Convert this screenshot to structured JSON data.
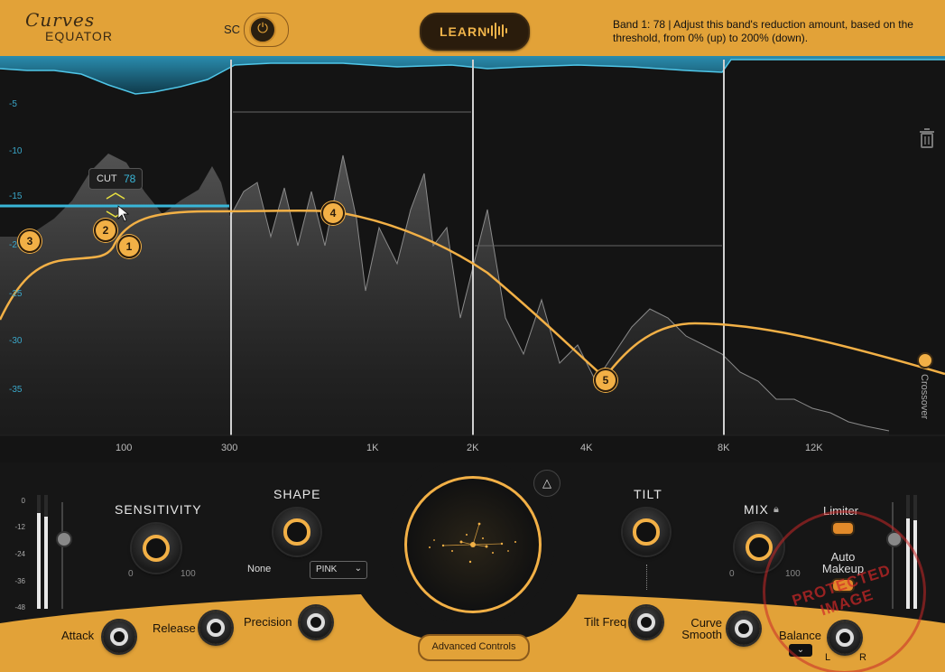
{
  "header": {
    "logo_line1": "Curves",
    "logo_line2": "EQUATOR",
    "sc_label": "SC",
    "learn_label": "LEARN",
    "hint_text": "Band 1: 78 | Adjust this band's reduction amount, based on the threshold, from 0% (up) to 200% (down)."
  },
  "graph": {
    "y_ticks": [
      "-5",
      "-10",
      "-15",
      "-20",
      "-25",
      "-30",
      "-35"
    ],
    "x_ticks": [
      "100",
      "300",
      "1K",
      "2K",
      "4K",
      "8K",
      "12K"
    ],
    "nodes": [
      "1",
      "2",
      "3",
      "4",
      "5"
    ],
    "cut_label": "CUT",
    "cut_value": "78",
    "crossover_label": "Crossover",
    "colors": {
      "curve": "#f2b046",
      "threshold": "#39b6d8",
      "spectrum": "#8a8a8a"
    }
  },
  "controls": {
    "sensitivity": {
      "label": "SENSITIVITY",
      "min": "0",
      "max": "100"
    },
    "shape": {
      "label": "SHAPE",
      "none": "None",
      "selected": "PINK"
    },
    "tilt": {
      "label": "TILT"
    },
    "mix": {
      "label": "MIX",
      "min": "0",
      "max": "100"
    },
    "limiter": "Limiter",
    "auto_makeup": "Auto Makeup",
    "attack": "Attack",
    "release": "Release",
    "precision": "Precision",
    "tilt_freq": "Tilt Freq",
    "curve_smooth": "Curve Smooth",
    "balance": "Balance",
    "balance_l": "L",
    "balance_r": "R",
    "advanced": "Advanced Controls",
    "meter_scale": [
      "0",
      "-12",
      "-24",
      "-36",
      "-48"
    ]
  },
  "watermark": "PROTECTED IMAGE"
}
